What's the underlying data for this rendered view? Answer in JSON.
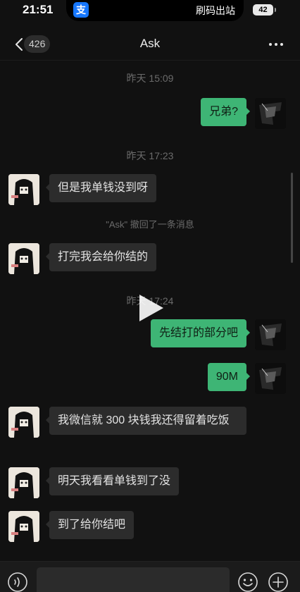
{
  "status_bar": {
    "time": "21:51",
    "island_app_icon": "支",
    "island_text": "刷码出站",
    "battery": "42"
  },
  "nav": {
    "unread_count": "426",
    "title": "Ask",
    "back_icon": "chevron-left-icon",
    "more_icon": "more-dots-icon"
  },
  "chat": {
    "timestamps": [
      "昨天 15:09",
      "昨天 17:23",
      "昨天 17:24"
    ],
    "system_notice": "\"Ask\" 撤回了一条消息",
    "messages": [
      {
        "from": "me",
        "text": "兄弟?"
      },
      {
        "from": "contact",
        "text": "但是我单钱没到呀"
      },
      {
        "from": "contact",
        "text": "打完我会给你结的"
      },
      {
        "from": "me",
        "text": "先结打的部分吧"
      },
      {
        "from": "me",
        "text": "90M"
      },
      {
        "from": "contact",
        "text": "我微信就 300 块钱我还得留着吃饭"
      },
      {
        "from": "contact",
        "text": "明天我看看单钱到了没"
      },
      {
        "from": "contact",
        "text": "到了给你结吧"
      }
    ]
  },
  "input_bar": {
    "input_value": "",
    "voice_icon": "voice-icon",
    "emoji_icon": "emoji-icon",
    "plus_icon": "plus-icon"
  },
  "colors": {
    "background": "#111111",
    "outgoing_bubble": "#3eb575",
    "incoming_bubble": "#2c2c2c",
    "timestamp_text": "#6b6b6b"
  }
}
